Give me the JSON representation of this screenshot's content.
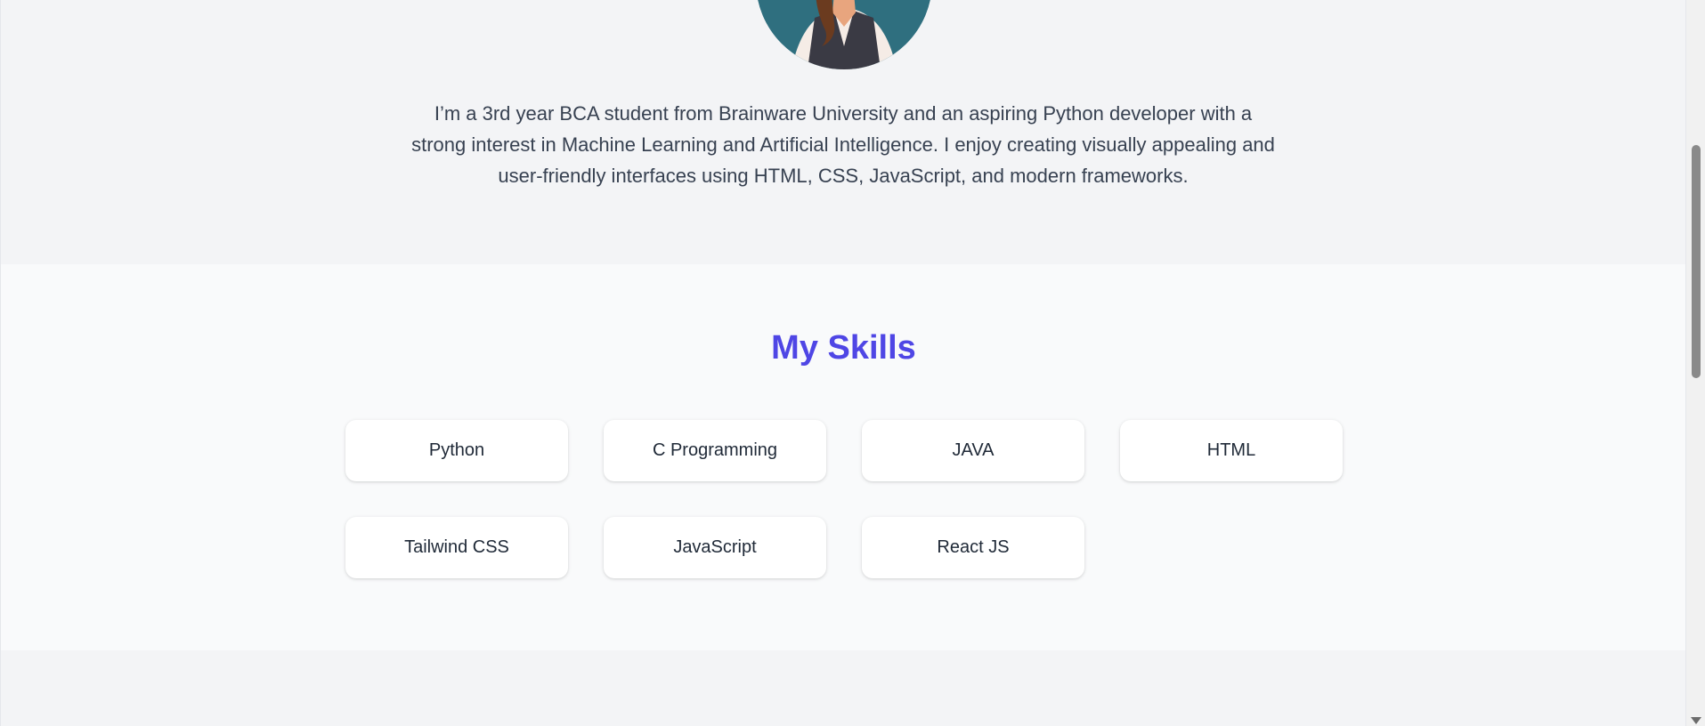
{
  "about": {
    "avatar_alt": "profile avatar",
    "bio": "I’m a 3rd year BCA student from Brainware University and an aspiring Python developer with a strong interest in Machine Learning and Artificial Intelligence. I enjoy creating visually appealing and user-friendly interfaces using HTML, CSS, JavaScript, and modern frameworks."
  },
  "skills": {
    "title": "My Skills",
    "items": [
      {
        "label": "Python"
      },
      {
        "label": "C Programming"
      },
      {
        "label": "JAVA"
      },
      {
        "label": "HTML"
      },
      {
        "label": "Tailwind CSS"
      },
      {
        "label": "JavaScript"
      },
      {
        "label": "React JS"
      }
    ]
  },
  "colors": {
    "accent": "#4f46e5",
    "avatar_bg": "#2f6f7f"
  }
}
